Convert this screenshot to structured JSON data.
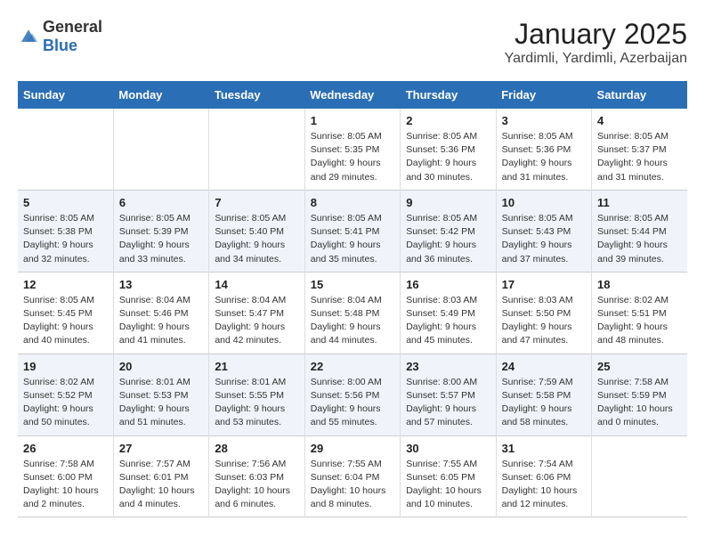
{
  "header": {
    "logo_general": "General",
    "logo_blue": "Blue",
    "title": "January 2025",
    "subtitle": "Yardimli, Yardimli, Azerbaijan"
  },
  "weekdays": [
    "Sunday",
    "Monday",
    "Tuesday",
    "Wednesday",
    "Thursday",
    "Friday",
    "Saturday"
  ],
  "weeks": [
    [
      {
        "day": "",
        "info": ""
      },
      {
        "day": "",
        "info": ""
      },
      {
        "day": "",
        "info": ""
      },
      {
        "day": "1",
        "info": "Sunrise: 8:05 AM\nSunset: 5:35 PM\nDaylight: 9 hours\nand 29 minutes."
      },
      {
        "day": "2",
        "info": "Sunrise: 8:05 AM\nSunset: 5:36 PM\nDaylight: 9 hours\nand 30 minutes."
      },
      {
        "day": "3",
        "info": "Sunrise: 8:05 AM\nSunset: 5:36 PM\nDaylight: 9 hours\nand 31 minutes."
      },
      {
        "day": "4",
        "info": "Sunrise: 8:05 AM\nSunset: 5:37 PM\nDaylight: 9 hours\nand 31 minutes."
      }
    ],
    [
      {
        "day": "5",
        "info": "Sunrise: 8:05 AM\nSunset: 5:38 PM\nDaylight: 9 hours\nand 32 minutes."
      },
      {
        "day": "6",
        "info": "Sunrise: 8:05 AM\nSunset: 5:39 PM\nDaylight: 9 hours\nand 33 minutes."
      },
      {
        "day": "7",
        "info": "Sunrise: 8:05 AM\nSunset: 5:40 PM\nDaylight: 9 hours\nand 34 minutes."
      },
      {
        "day": "8",
        "info": "Sunrise: 8:05 AM\nSunset: 5:41 PM\nDaylight: 9 hours\nand 35 minutes."
      },
      {
        "day": "9",
        "info": "Sunrise: 8:05 AM\nSunset: 5:42 PM\nDaylight: 9 hours\nand 36 minutes."
      },
      {
        "day": "10",
        "info": "Sunrise: 8:05 AM\nSunset: 5:43 PM\nDaylight: 9 hours\nand 37 minutes."
      },
      {
        "day": "11",
        "info": "Sunrise: 8:05 AM\nSunset: 5:44 PM\nDaylight: 9 hours\nand 39 minutes."
      }
    ],
    [
      {
        "day": "12",
        "info": "Sunrise: 8:05 AM\nSunset: 5:45 PM\nDaylight: 9 hours\nand 40 minutes."
      },
      {
        "day": "13",
        "info": "Sunrise: 8:04 AM\nSunset: 5:46 PM\nDaylight: 9 hours\nand 41 minutes."
      },
      {
        "day": "14",
        "info": "Sunrise: 8:04 AM\nSunset: 5:47 PM\nDaylight: 9 hours\nand 42 minutes."
      },
      {
        "day": "15",
        "info": "Sunrise: 8:04 AM\nSunset: 5:48 PM\nDaylight: 9 hours\nand 44 minutes."
      },
      {
        "day": "16",
        "info": "Sunrise: 8:03 AM\nSunset: 5:49 PM\nDaylight: 9 hours\nand 45 minutes."
      },
      {
        "day": "17",
        "info": "Sunrise: 8:03 AM\nSunset: 5:50 PM\nDaylight: 9 hours\nand 47 minutes."
      },
      {
        "day": "18",
        "info": "Sunrise: 8:02 AM\nSunset: 5:51 PM\nDaylight: 9 hours\nand 48 minutes."
      }
    ],
    [
      {
        "day": "19",
        "info": "Sunrise: 8:02 AM\nSunset: 5:52 PM\nDaylight: 9 hours\nand 50 minutes."
      },
      {
        "day": "20",
        "info": "Sunrise: 8:01 AM\nSunset: 5:53 PM\nDaylight: 9 hours\nand 51 minutes."
      },
      {
        "day": "21",
        "info": "Sunrise: 8:01 AM\nSunset: 5:55 PM\nDaylight: 9 hours\nand 53 minutes."
      },
      {
        "day": "22",
        "info": "Sunrise: 8:00 AM\nSunset: 5:56 PM\nDaylight: 9 hours\nand 55 minutes."
      },
      {
        "day": "23",
        "info": "Sunrise: 8:00 AM\nSunset: 5:57 PM\nDaylight: 9 hours\nand 57 minutes."
      },
      {
        "day": "24",
        "info": "Sunrise: 7:59 AM\nSunset: 5:58 PM\nDaylight: 9 hours\nand 58 minutes."
      },
      {
        "day": "25",
        "info": "Sunrise: 7:58 AM\nSunset: 5:59 PM\nDaylight: 10 hours\nand 0 minutes."
      }
    ],
    [
      {
        "day": "26",
        "info": "Sunrise: 7:58 AM\nSunset: 6:00 PM\nDaylight: 10 hours\nand 2 minutes."
      },
      {
        "day": "27",
        "info": "Sunrise: 7:57 AM\nSunset: 6:01 PM\nDaylight: 10 hours\nand 4 minutes."
      },
      {
        "day": "28",
        "info": "Sunrise: 7:56 AM\nSunset: 6:03 PM\nDaylight: 10 hours\nand 6 minutes."
      },
      {
        "day": "29",
        "info": "Sunrise: 7:55 AM\nSunset: 6:04 PM\nDaylight: 10 hours\nand 8 minutes."
      },
      {
        "day": "30",
        "info": "Sunrise: 7:55 AM\nSunset: 6:05 PM\nDaylight: 10 hours\nand 10 minutes."
      },
      {
        "day": "31",
        "info": "Sunrise: 7:54 AM\nSunset: 6:06 PM\nDaylight: 10 hours\nand 12 minutes."
      },
      {
        "day": "",
        "info": ""
      }
    ]
  ]
}
